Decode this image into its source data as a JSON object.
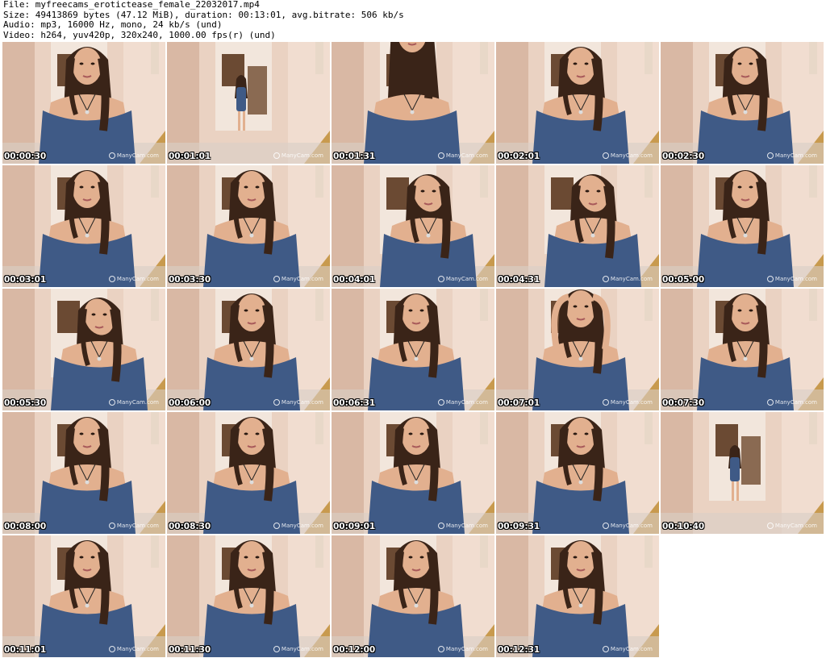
{
  "header": {
    "file_line": "File: myfreecams_erotictease_female_22032017.mp4",
    "size_line": "Size: 49413869 bytes (47.12 MiB), duration: 00:13:01, avg.bitrate: 506 kb/s",
    "audio_line": "Audio: mp3, 16000 Hz, mono, 24 kb/s (und)",
    "video_line": "Video: h264, yuv420p, 320x240, 1000.00 fps(r) (und)"
  },
  "watermark_text": "ManyCam.com",
  "thumbnails": [
    {
      "time": "00:00:30",
      "scene": "closeup"
    },
    {
      "time": "00:01:01",
      "scene": "far"
    },
    {
      "time": "00:01:31",
      "scene": "body"
    },
    {
      "time": "00:02:01",
      "scene": "closeup"
    },
    {
      "time": "00:02:30",
      "scene": "closeup"
    },
    {
      "time": "00:03:01",
      "scene": "closeup"
    },
    {
      "time": "00:03:30",
      "scene": "closeup"
    },
    {
      "time": "00:04:01",
      "scene": "lean"
    },
    {
      "time": "00:04:31",
      "scene": "lean"
    },
    {
      "time": "00:05:00",
      "scene": "closeup"
    },
    {
      "time": "00:05:30",
      "scene": "lean"
    },
    {
      "time": "00:06:00",
      "scene": "closeup"
    },
    {
      "time": "00:06:31",
      "scene": "closeup"
    },
    {
      "time": "00:07:01",
      "scene": "arms"
    },
    {
      "time": "00:07:30",
      "scene": "closeup"
    },
    {
      "time": "00:08:00",
      "scene": "closeup"
    },
    {
      "time": "00:08:30",
      "scene": "closeup"
    },
    {
      "time": "00:09:01",
      "scene": "closeup"
    },
    {
      "time": "00:09:31",
      "scene": "closeup"
    },
    {
      "time": "00:10:40",
      "scene": "far"
    },
    {
      "time": "00:11:01",
      "scene": "closeup"
    },
    {
      "time": "00:11:30",
      "scene": "closeup"
    },
    {
      "time": "00:12:00",
      "scene": "closeup"
    },
    {
      "time": "00:12:31",
      "scene": "closeup"
    }
  ],
  "colors": {
    "wall": "#ead2c2",
    "wall_shadow": "#d9b8a4",
    "door_frame": "#f2e6dc",
    "cabinet": "#6b4a33",
    "chair": "#c89a4e",
    "dress": "#3f5a86",
    "skin": "#e2b08f",
    "hair": "#3a2418",
    "floor": "#d8cfc6"
  }
}
